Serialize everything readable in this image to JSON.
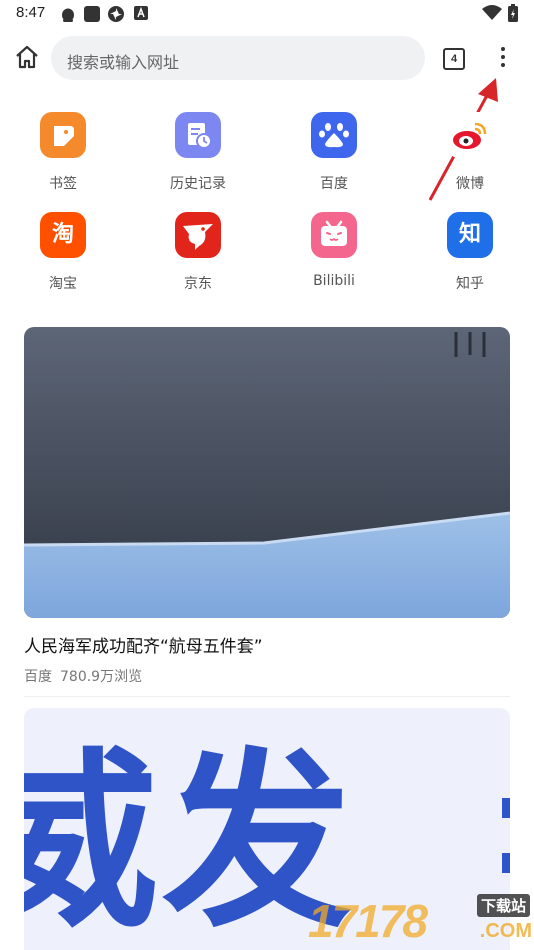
{
  "status_bar": {
    "time": "8:47",
    "icons": [
      "qq-penguin-icon",
      "app-square-icon",
      "pinwheel-icon",
      "text-a-icon",
      "wifi-icon",
      "battery-charging-icon"
    ]
  },
  "toolbar": {
    "search_placeholder": "搜索或输入网址",
    "tab_count": "4",
    "home_icon": "home-icon",
    "menu_icon": "more-vertical-icon"
  },
  "shortcuts": [
    {
      "label": "书签",
      "icon": "bookmark-icon",
      "color": "#f58a2c"
    },
    {
      "label": "历史记录",
      "icon": "history-icon",
      "color": "#7d87f2"
    },
    {
      "label": "百度",
      "icon": "baidu-paw-icon",
      "color": "#3f67ee"
    },
    {
      "label": "微博",
      "icon": "weibo-icon",
      "color": "#e6162d"
    },
    {
      "label": "淘宝",
      "icon": "taobao-icon",
      "glyph": "淘",
      "color": "#ff5000"
    },
    {
      "label": "京东",
      "icon": "jd-icon",
      "color": "#e1251b"
    },
    {
      "label": "Bilibili",
      "icon": "bilibili-tv-icon",
      "color": "#f5668f"
    },
    {
      "label": "知乎",
      "icon": "zhihu-icon",
      "glyph": "知",
      "color": "#1e6fe8"
    }
  ],
  "feed": [
    {
      "title": "人民海军成功配齐“航母五件套”",
      "source": "百度",
      "views": "780.9万浏览"
    },
    {
      "image_text": "威发"
    }
  ],
  "watermark": {
    "digits": "17178",
    "badge": "下载站",
    "domain": ".COM"
  },
  "colors": {
    "annotation_red": "#d6262a",
    "search_bg": "#f0f1f3"
  }
}
